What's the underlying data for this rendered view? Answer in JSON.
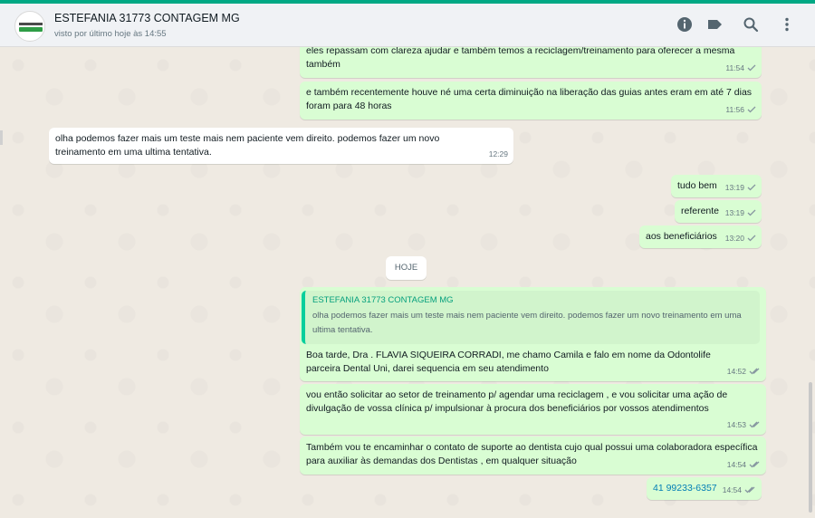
{
  "header": {
    "contact_name": "ESTEFANIA 31773 CONTAGEM MG",
    "last_seen": "visto por último hoje às 14:55"
  },
  "icons": {
    "info": "info-icon",
    "label": "label-icon",
    "search": "search-icon",
    "menu": "more-vertical-icon"
  },
  "colors": {
    "accent": "#00a884",
    "outgoing_bubble": "#d9fdd3",
    "incoming_bubble": "#ffffff",
    "read_tick": "#8696a0",
    "link": "#027eb5"
  },
  "messages": [
    {
      "direction": "out",
      "text": "eles repassam com clareza ajudar e também temos a reciclagem/treinamento para oferecer a mesma também",
      "time": "11:54",
      "status": "sent"
    },
    {
      "direction": "out",
      "text": "e também recentemente houve né uma certa diminuição na liberação das guias antes eram em até 7 dias foram para 48 horas",
      "time": "11:56",
      "status": "sent"
    },
    {
      "direction": "in",
      "text": "olha podemos fazer mais um teste mais nem paciente vem direito. podemos fazer um novo treinamento em uma ultima tentativa.",
      "time": "12:29"
    },
    {
      "direction": "out",
      "text": "tudo bem",
      "time": "13:19",
      "status": "sent"
    },
    {
      "direction": "out",
      "text": "referente",
      "time": "13:19",
      "status": "sent"
    },
    {
      "direction": "out",
      "text": "aos beneficiários",
      "time": "13:20",
      "status": "sent"
    },
    {
      "direction": "out",
      "text": "Boa tarde, Dra . FLAVIA SIQUEIRA CORRADI, me chamo Camila e falo em nome da Odontolife parceira Dental Uni, darei sequencia em seu atendimento",
      "time": "14:52",
      "status": "delivered"
    },
    {
      "direction": "out",
      "text": "vou então solicitar ao setor de treinamento p/ agendar uma reciclagem , e vou solicitar uma ação de divulgação de vossa clínica p/ impulsionar à procura dos beneficiários por vossos atendimentos",
      "time": "14:53",
      "status": "delivered"
    },
    {
      "direction": "out",
      "text": "Também vou te encaminhar o contato de suporte ao dentista cujo qual possui uma colaboradora específica para auxiliar às demandas dos Dentistas , em qualquer situação",
      "time": "14:54",
      "status": "delivered"
    },
    {
      "direction": "out",
      "text": "41 99233-6357",
      "time": "14:54",
      "status": "delivered"
    }
  ],
  "day_divider": "HOJE",
  "quoted": {
    "author": "ESTEFANIA 31773 CONTAGEM MG",
    "text": "olha podemos fazer mais um teste mais nem paciente vem direito. podemos fazer um novo treinamento em uma ultima tentativa."
  }
}
